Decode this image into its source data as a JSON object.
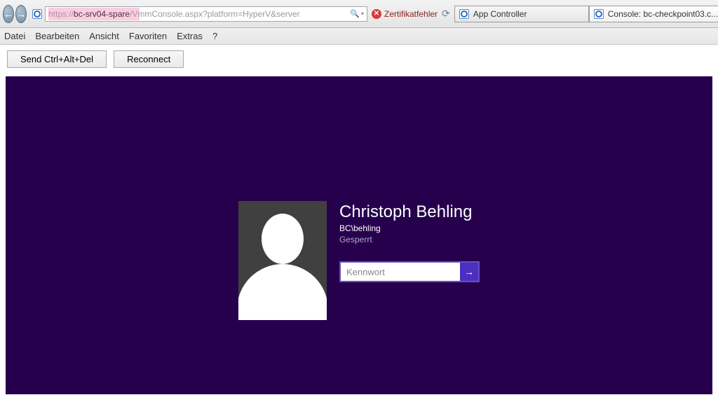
{
  "chrome": {
    "url_scheme": "https://",
    "url_host": "bc-srv04-spare",
    "url_rest": "/VmmConsole.aspx?platform=HyperV&server",
    "cert_error": "Zertifikatfehler",
    "tabs": [
      {
        "label": "App Controller",
        "has_close": false
      },
      {
        "label": "Console: bc-checkpoint03.c...",
        "has_close": true
      }
    ]
  },
  "menubar": [
    "Datei",
    "Bearbeiten",
    "Ansicht",
    "Favoriten",
    "Extras",
    "?"
  ],
  "toolbar": {
    "send_cad": "Send Ctrl+Alt+Del",
    "reconnect": "Reconnect"
  },
  "lockscreen": {
    "full_name": "Christoph Behling",
    "account": "BC\\behling",
    "status": "Gesperrt",
    "password_placeholder": "Kennwort",
    "submit_glyph": "→"
  }
}
